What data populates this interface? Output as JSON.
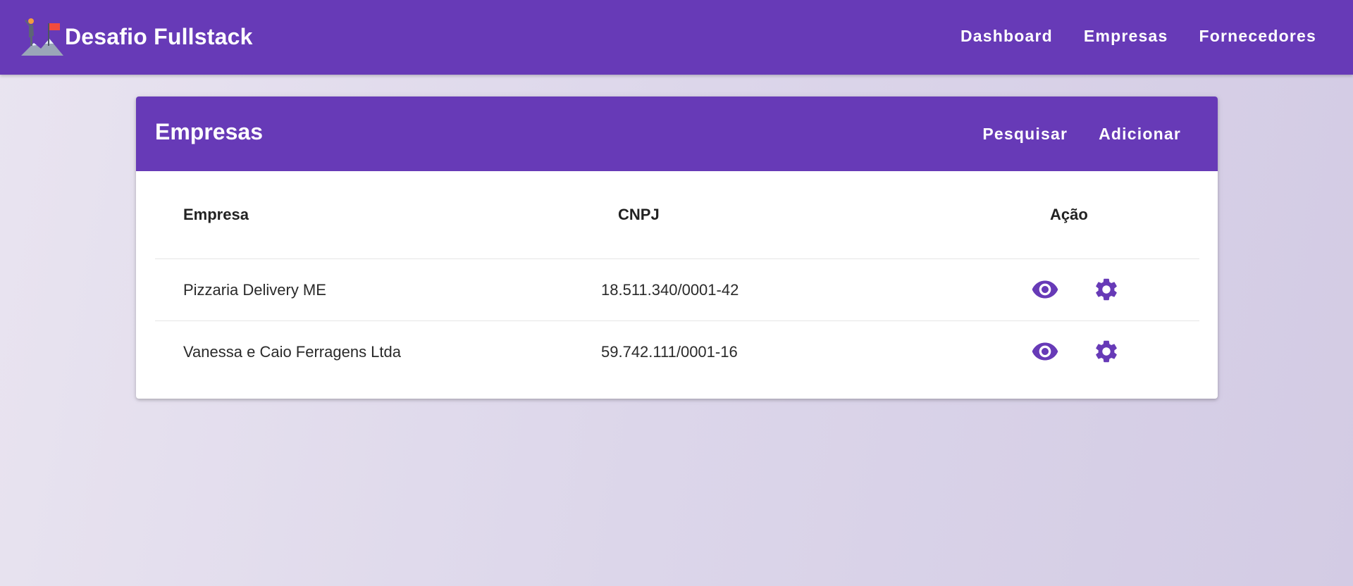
{
  "app": {
    "title": "Desafio Fullstack",
    "logo_icon": "mountain-flag-icon"
  },
  "nav": {
    "items": [
      {
        "label": "Dashboard"
      },
      {
        "label": "Empresas"
      },
      {
        "label": "Fornecedores"
      }
    ]
  },
  "card": {
    "title": "Empresas",
    "actions": {
      "search_label": "Pesquisar",
      "add_label": "Adicionar"
    }
  },
  "table": {
    "columns": [
      "Empresa",
      "CNPJ",
      "Ação"
    ],
    "rows": [
      {
        "empresa": "Pizzaria Delivery ME",
        "cnpj": "18.511.340/0001-42",
        "actions": [
          "eye-icon",
          "gear-icon"
        ]
      },
      {
        "empresa": "Vanessa e Caio Ferragens Ltda",
        "cnpj": "59.742.111/0001-16",
        "actions": [
          "eye-icon",
          "gear-icon"
        ]
      }
    ]
  },
  "colors": {
    "primary": "#673ab7",
    "background_start": "#e9e4f0",
    "background_end": "#d3cbe4",
    "card": "#ffffff"
  }
}
